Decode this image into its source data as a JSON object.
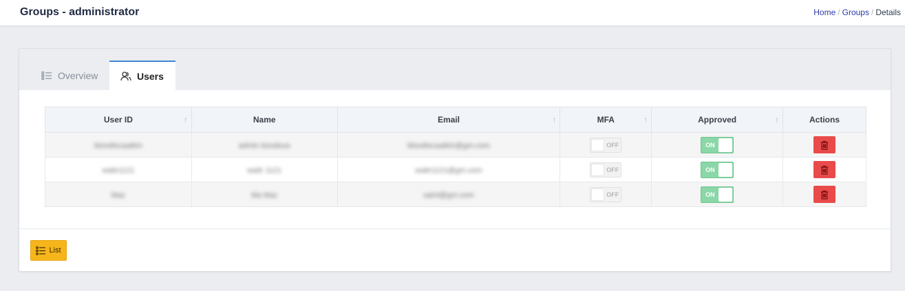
{
  "header": {
    "title": "Groups - administrator",
    "breadcrumb": {
      "home": "Home",
      "sep": "/",
      "groups": "Groups",
      "current": "Details"
    }
  },
  "tabs": [
    {
      "label": "Overview",
      "icon": "list-icon",
      "active": false
    },
    {
      "label": "Users",
      "icon": "users-icon",
      "active": true
    }
  ],
  "table": {
    "columns": [
      "User ID",
      "Name",
      "Email",
      "MFA",
      "Approved",
      "Actions"
    ],
    "rows": [
      {
        "user_id": "bloodiscaatkin",
        "name": "admin boodous",
        "email": "bloodiscaatkin@gm.com",
        "mfa": "OFF",
        "approved": "ON"
      },
      {
        "user_id": "waitr1121",
        "name": "waitr 1121",
        "email": "waitr1121@gm.com",
        "mfa": "OFF",
        "approved": "ON"
      },
      {
        "user_id": "blaz",
        "name": "bla blaz",
        "email": "saint@gm.com",
        "mfa": "OFF",
        "approved": "ON"
      }
    ]
  },
  "footer": {
    "list_label": "List"
  },
  "colors": {
    "accent": "#3c87d6",
    "on": "#8ad7a8",
    "danger": "#e94b4b",
    "warning": "#f7b51c"
  }
}
